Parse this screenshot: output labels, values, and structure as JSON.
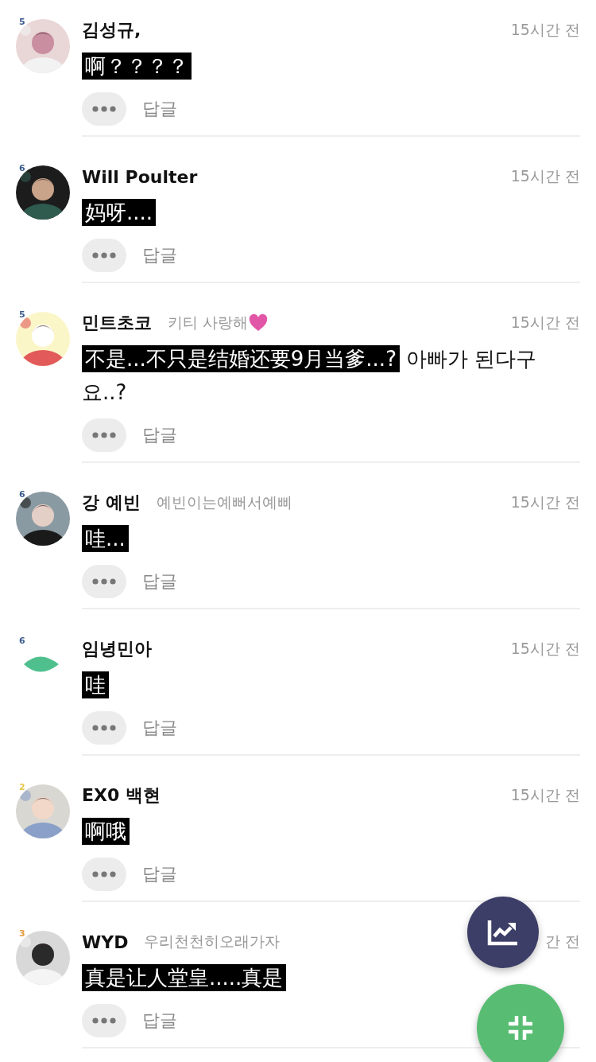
{
  "comments": [
    {
      "avatar": {
        "kind": "picture"
      },
      "level": {
        "text": "5",
        "color": "#3b5b8e"
      },
      "name": "김성규,",
      "time": "15시간 전",
      "segments": [
        {
          "text": "啊？？？？",
          "highlight": true
        }
      ],
      "reply": "답글"
    },
    {
      "avatar": {
        "kind": "picture"
      },
      "level": {
        "text": "6",
        "color": "#3b5b8e"
      },
      "name": "Will Poulter",
      "time": "15시간 전",
      "segments": [
        {
          "text": "妈呀....",
          "highlight": true
        }
      ],
      "reply": "답글"
    },
    {
      "avatar": {
        "kind": "picture"
      },
      "level": {
        "text": "5",
        "color": "#3b5b8e"
      },
      "name": "민트초코",
      "subtitle": "키티 사랑해",
      "heart": true,
      "time": "15시간 전",
      "segments": [
        {
          "text": "不是...不只是结婚还要9月当爹...?",
          "highlight": true
        },
        {
          "text": " 아빠가 된다구요..?",
          "highlight": false
        }
      ],
      "reply": "답글"
    },
    {
      "avatar": {
        "kind": "picture"
      },
      "level": {
        "text": "6",
        "color": "#3b5b8e"
      },
      "name": "강 예빈",
      "subtitle": "예빈이는예뻐서예삐",
      "time": "15시간 전",
      "segments": [
        {
          "text": "哇...",
          "highlight": true
        }
      ],
      "reply": "답글"
    },
    {
      "avatar": {
        "kind": "leaf"
      },
      "level": {
        "text": "6",
        "color": "#3b5b8e"
      },
      "name": "임녕민아",
      "time": "15시간 전",
      "segments": [
        {
          "text": "哇",
          "highlight": true
        }
      ],
      "reply": "답글"
    },
    {
      "avatar": {
        "kind": "picture"
      },
      "level": {
        "text": "2",
        "color": "#e8c64a"
      },
      "name": "EX0 백현",
      "time": "15시간 전",
      "segments": [
        {
          "text": "啊哦",
          "highlight": true
        }
      ],
      "reply": "답글"
    },
    {
      "avatar": {
        "kind": "picture"
      },
      "level": {
        "text": "3",
        "color": "#e39a3c"
      },
      "name": "WYD",
      "subtitle": "우리천천히오래가자",
      "time": "간 전",
      "segments": [
        {
          "text": "真是让人堂皇.....真是",
          "highlight": true
        }
      ],
      "reply": "답글"
    }
  ]
}
